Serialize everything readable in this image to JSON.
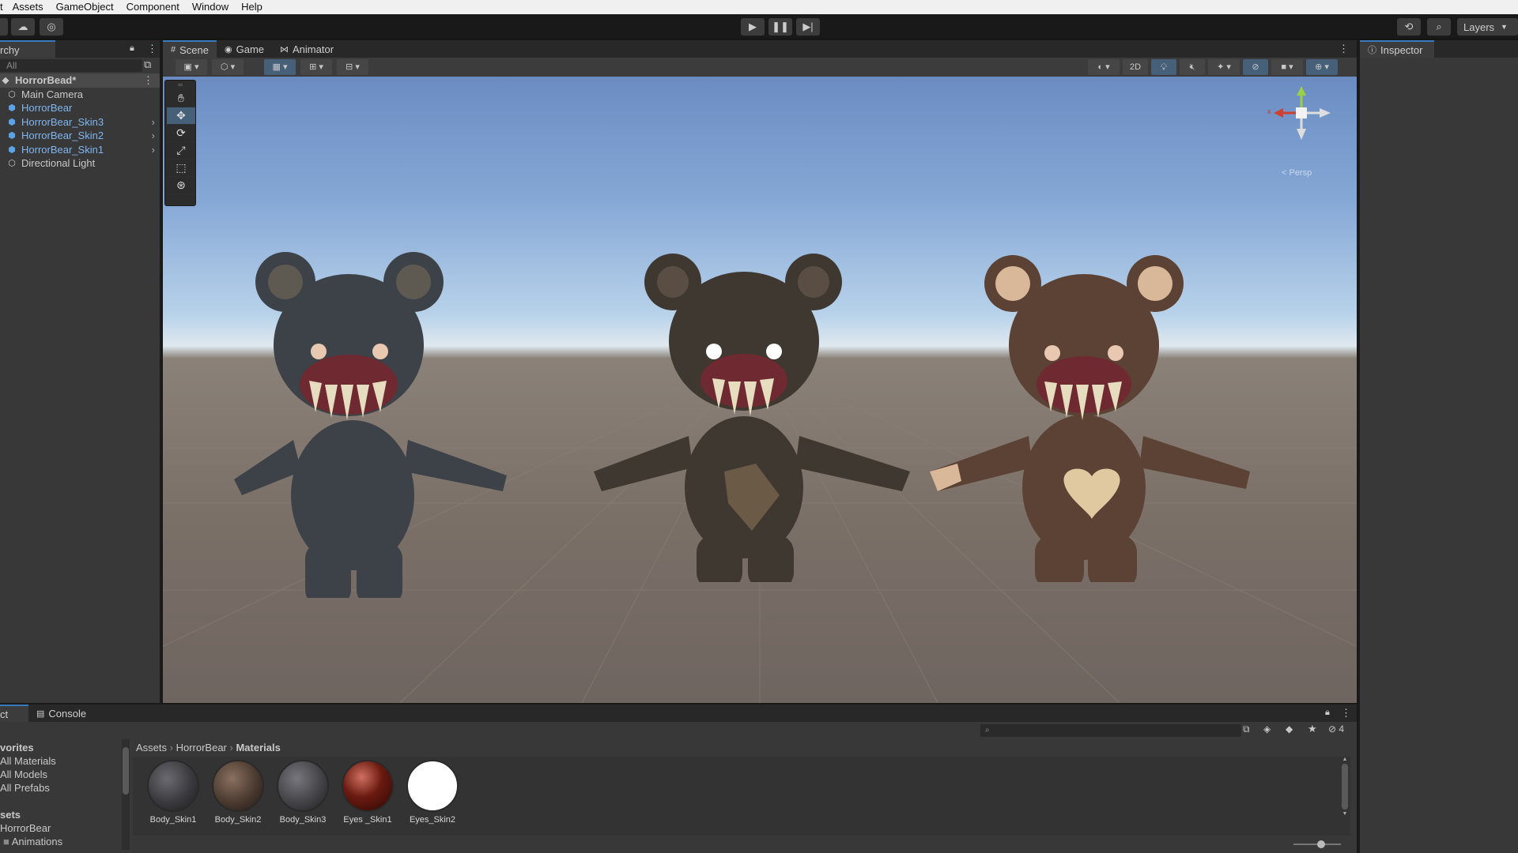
{
  "menu": [
    "t",
    "Assets",
    "GameObject",
    "Component",
    "Window",
    "Help"
  ],
  "toolbar": {
    "layers_label": "Layers"
  },
  "hierarchy": {
    "tab_label": "rchy",
    "search_placeholder": "All",
    "scene_name": "HorrorBead*",
    "items": [
      {
        "label": "Main Camera",
        "blue": false
      },
      {
        "label": "HorrorBear",
        "blue": true
      },
      {
        "label": "HorrorBear_Skin3",
        "blue": true
      },
      {
        "label": "HorrorBear_Skin2",
        "blue": true
      },
      {
        "label": "HorrorBear_Skin1",
        "blue": true
      },
      {
        "label": "Directional Light",
        "blue": false
      }
    ]
  },
  "scene": {
    "tabs": [
      "Scene",
      "Game",
      "Animator"
    ],
    "mode_2d": "2D",
    "persp_label": "< Persp",
    "gizmo_x": "x"
  },
  "inspector": {
    "tab_label": "Inspector"
  },
  "project": {
    "tab_project": "ct",
    "tab_console": "Console",
    "hidden_count": "4",
    "favorites_title": "vorites",
    "favorites": [
      "All Materials",
      "All Models",
      "All Prefabs"
    ],
    "assets_title": "sets",
    "assets_tree": [
      "HorrorBear",
      "Animations"
    ],
    "breadcrumb": [
      "Assets",
      "HorrorBear",
      "Materials"
    ],
    "assets": [
      {
        "name": "Body_Skin1",
        "color": "#3a3a3e"
      },
      {
        "name": "Body_Skin2",
        "color": "#4a3a30"
      },
      {
        "name": "Body_Skin3",
        "color": "#444448"
      },
      {
        "name": "Eyes _Skin1",
        "color": "#6a1a10"
      },
      {
        "name": "Eyes_Skin2",
        "color": "#ffffff"
      }
    ]
  }
}
